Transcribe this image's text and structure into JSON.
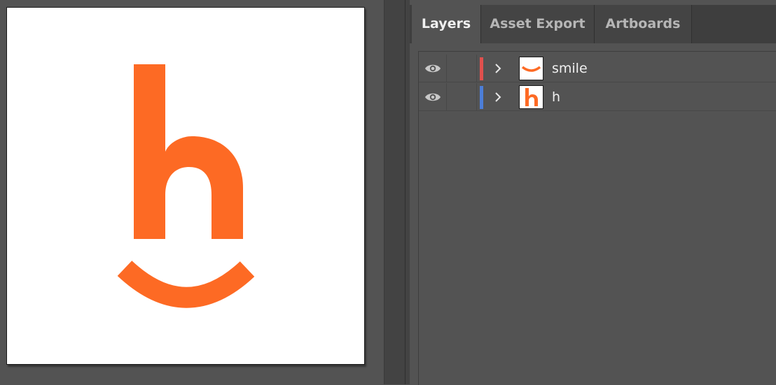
{
  "artboard": {
    "logo_color": "#fd6a24",
    "background": "#ffffff"
  },
  "panel": {
    "tabs": [
      {
        "label": "Layers",
        "active": true
      },
      {
        "label": "Asset Export",
        "active": false
      },
      {
        "label": "Artboards",
        "active": false
      }
    ],
    "layers": [
      {
        "name": "smile",
        "color": "#e0504d",
        "visible": true,
        "icon": "smile-thumbnail"
      },
      {
        "name": "h",
        "color": "#4c7ed8",
        "visible": true,
        "icon": "h-thumbnail"
      }
    ]
  },
  "icons": {
    "visibility": "eye-icon",
    "expand": "chevron-right-icon"
  }
}
